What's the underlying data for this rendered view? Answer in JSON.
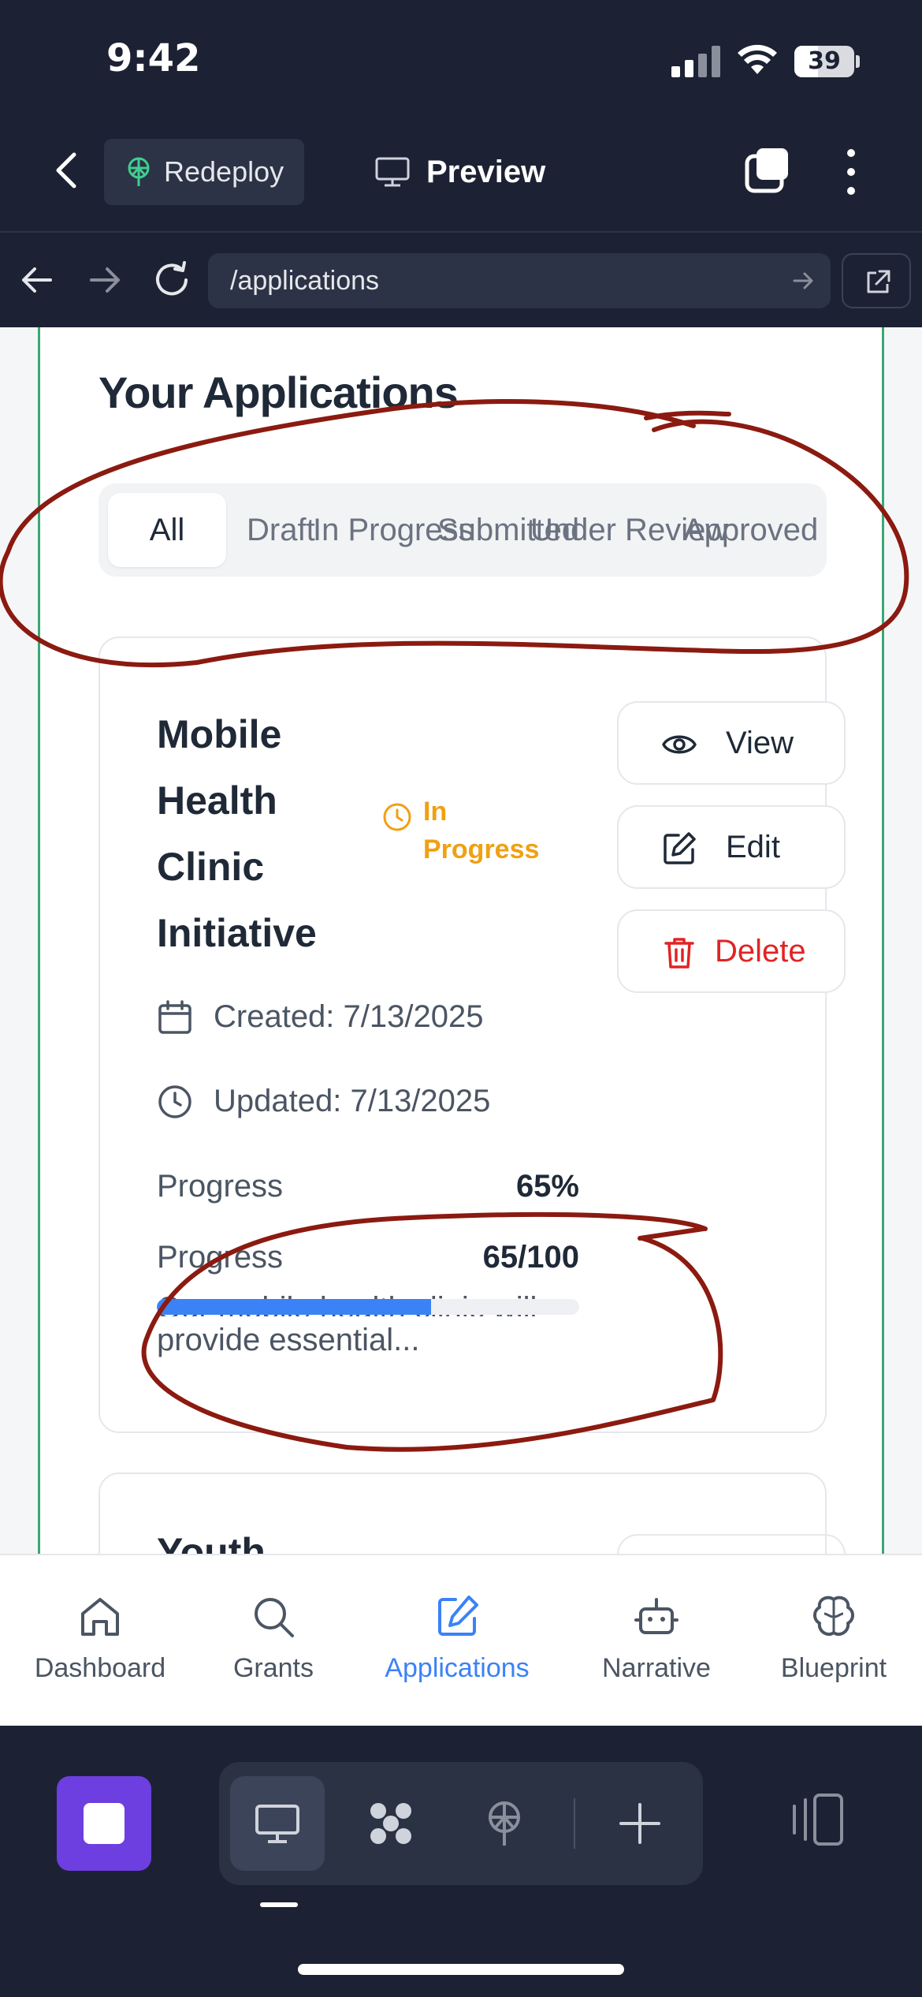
{
  "status_bar": {
    "time": "9:42",
    "battery": "39"
  },
  "app_bar": {
    "redeploy_label": "Redeploy",
    "preview_label": "Preview"
  },
  "browser": {
    "url": "/applications"
  },
  "page": {
    "title": "Your Applications",
    "filters": [
      {
        "label": "All",
        "active": true
      },
      {
        "label": "Draft"
      },
      {
        "label": "In Progress"
      },
      {
        "label": "Submitted"
      },
      {
        "label": "Under Review"
      },
      {
        "label": "Approved"
      }
    ],
    "application": {
      "title": "Mobile Health Clinic Initiative",
      "status": "In Progress",
      "actions": {
        "view": "View",
        "edit": "Edit",
        "delete": "Delete"
      },
      "created": "Created: 7/13/2025",
      "updated": "Updated: 7/13/2025",
      "progress_label": "Progress",
      "progress_value": "65%",
      "score_label": "Progress",
      "score_value": "65/100",
      "progress_fraction": 0.65,
      "description_line1": "Our mobile health clinic will",
      "description_line2": "provide essential..."
    },
    "next_card_title_peek": "Youth"
  },
  "tabbar": {
    "items": [
      {
        "label": "Dashboard",
        "icon": "home-icon"
      },
      {
        "label": "Grants",
        "icon": "search-icon"
      },
      {
        "label": "Applications",
        "icon": "edit-square-icon",
        "active": true
      },
      {
        "label": "Narrative",
        "icon": "robot-icon"
      },
      {
        "label": "Blueprint",
        "icon": "brain-icon"
      }
    ]
  },
  "colors": {
    "accent": "#3b82f6",
    "status_in_progress": "#f0a013",
    "danger": "#e02424",
    "annotation": "#8b1a10",
    "toolbar_bg": "#1c2233",
    "stop_button": "#6d3ee0"
  }
}
